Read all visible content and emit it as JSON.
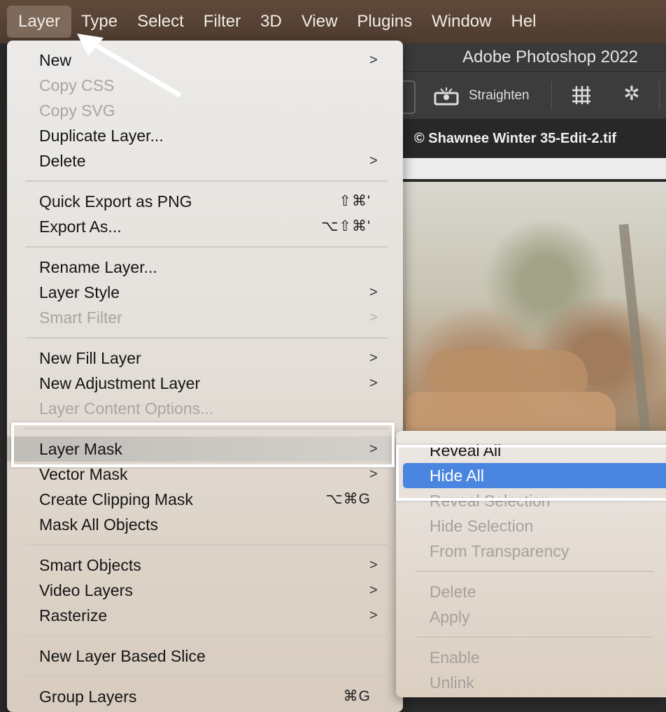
{
  "menubar": {
    "items": [
      {
        "label": "Layer"
      },
      {
        "label": "Type"
      },
      {
        "label": "Select"
      },
      {
        "label": "Filter"
      },
      {
        "label": "3D"
      },
      {
        "label": "View"
      },
      {
        "label": "Plugins"
      },
      {
        "label": "Window"
      },
      {
        "label": "Hel"
      }
    ]
  },
  "app": {
    "title": "Adobe Photoshop 2022",
    "straighten_label": "Straighten",
    "document_tab": "© Shawnee Winter 35-Edit-2.tif"
  },
  "layer_menu": {
    "items": [
      {
        "label": "New",
        "submenu": true,
        "enabled": true
      },
      {
        "label": "Copy CSS",
        "enabled": false
      },
      {
        "label": "Copy SVG",
        "enabled": false
      },
      {
        "label": "Duplicate Layer...",
        "enabled": true
      },
      {
        "label": "Delete",
        "submenu": true,
        "enabled": true
      },
      {
        "label": "Quick Export as PNG",
        "shortcut": "⇧⌘'",
        "enabled": true
      },
      {
        "label": "Export As...",
        "shortcut": "⌥⇧⌘'",
        "enabled": true
      },
      {
        "label": "Rename Layer...",
        "enabled": true
      },
      {
        "label": "Layer Style",
        "submenu": true,
        "enabled": true
      },
      {
        "label": "Smart Filter",
        "submenu": true,
        "enabled": false
      },
      {
        "label": "New Fill Layer",
        "submenu": true,
        "enabled": true
      },
      {
        "label": "New Adjustment Layer",
        "submenu": true,
        "enabled": true
      },
      {
        "label": "Layer Content Options...",
        "enabled": false
      },
      {
        "label": "Layer Mask",
        "submenu": true,
        "enabled": true,
        "highlighted": true
      },
      {
        "label": "Vector Mask",
        "submenu": true,
        "enabled": true
      },
      {
        "label": "Create Clipping Mask",
        "shortcut": "⌥⌘G",
        "enabled": true
      },
      {
        "label": "Mask All Objects",
        "enabled": true
      },
      {
        "label": "Smart Objects",
        "submenu": true,
        "enabled": true
      },
      {
        "label": "Video Layers",
        "submenu": true,
        "enabled": true
      },
      {
        "label": "Rasterize",
        "submenu": true,
        "enabled": true
      },
      {
        "label": "New Layer Based Slice",
        "enabled": true
      },
      {
        "label": "Group Layers",
        "shortcut": "⌘G",
        "enabled": true
      }
    ],
    "arrow_glyph": ">"
  },
  "layer_mask_submenu": {
    "items": [
      {
        "label": "Reveal All",
        "enabled": true
      },
      {
        "label": "Hide All",
        "enabled": true,
        "selected": true
      },
      {
        "label": "Reveal Selection",
        "enabled": false
      },
      {
        "label": "Hide Selection",
        "enabled": false
      },
      {
        "label": "From Transparency",
        "enabled": false
      },
      {
        "label": "Delete",
        "enabled": false
      },
      {
        "label": "Apply",
        "enabled": false
      },
      {
        "label": "Enable",
        "enabled": false
      },
      {
        "label": "Unlink",
        "enabled": false
      }
    ]
  },
  "colors": {
    "selection_blue": "#4a86e0",
    "menubar_brown": "#5a4537",
    "annotation_frame": "#ffffff"
  }
}
